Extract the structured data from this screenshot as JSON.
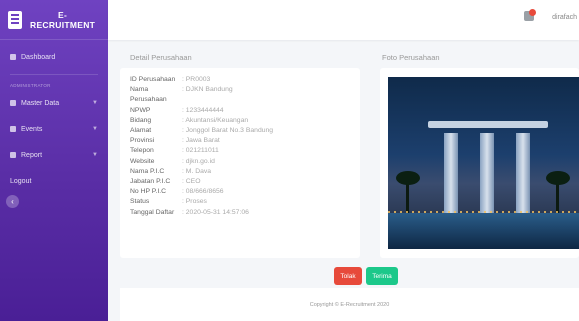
{
  "app": {
    "brand_top": "E-",
    "brand_bottom": "RECRUITMENT"
  },
  "sidebar": {
    "dashboard": "Dashboard",
    "section_label": "ADMINISTRATOR",
    "items": [
      {
        "label": "Master Data"
      },
      {
        "label": "Events"
      },
      {
        "label": "Report"
      }
    ],
    "logout": "Logout"
  },
  "topbar": {
    "username": "dirafach"
  },
  "detail": {
    "title": "Detail Perusahaan",
    "rows": [
      {
        "label": "ID Perusahaan",
        "value": ": PR0003"
      },
      {
        "label": "Nama Perusahaan",
        "value": ": DJKN Bandung"
      },
      {
        "label": "NPWP",
        "value": ": 1233444444"
      },
      {
        "label": "Bidang",
        "value": ": Akuntansi/Keuangan"
      },
      {
        "label": "Alamat",
        "value": ": Jonggol Barat No.3 Bandung"
      },
      {
        "label": "Provinsi",
        "value": ": Jawa Barat"
      },
      {
        "label": "Telepon",
        "value": ": 021211011"
      },
      {
        "label": "Website",
        "value": ": djkn.go.id"
      },
      {
        "label": "Nama P.I.C",
        "value": ": M. Dava"
      },
      {
        "label": "Jabatan P.I.C",
        "value": ": CEO"
      },
      {
        "label": "No HP P.I.C",
        "value": ": 08/666/8656"
      },
      {
        "label": "Status",
        "value": ": Proses"
      },
      {
        "label": "Tanggal Daftar",
        "value": ": 2020-05-31 14:57:06"
      }
    ]
  },
  "photo": {
    "title": "Foto Perusahaan"
  },
  "actions": {
    "reject": "Tolak",
    "accept": "Terima"
  },
  "footer": {
    "copyright": "Copyright © E-Recruitment 2020"
  }
}
